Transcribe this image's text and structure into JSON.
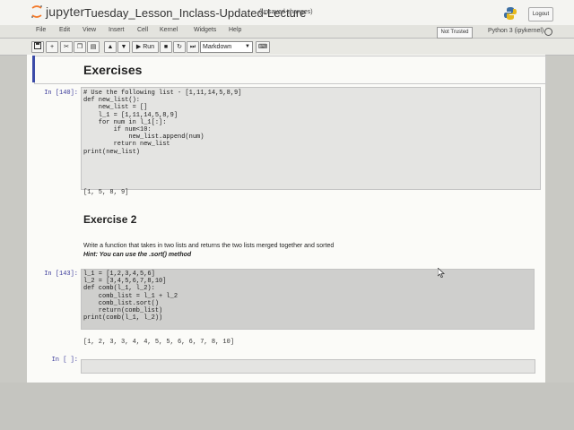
{
  "header": {
    "app_name": "jupyter",
    "notebook_title": "Tuesday_Lesson_Inclass-Updated-Lecture",
    "save_status": "(unsaved changes)",
    "logout_label": "Logout"
  },
  "menu": {
    "items": [
      {
        "label": "File"
      },
      {
        "label": "Edit"
      },
      {
        "label": "View"
      },
      {
        "label": "Insert"
      },
      {
        "label": "Cell"
      },
      {
        "label": "Kernel"
      },
      {
        "label": "Widgets"
      },
      {
        "label": "Help"
      }
    ],
    "trust_label": "Not Trusted",
    "kernel_label": "Python 3 (ipykernel)"
  },
  "toolbar": {
    "run_label": "Run",
    "cell_type": "Markdown"
  },
  "cells": {
    "heading1": "Exercises",
    "cell1_prompt": "In [140]:",
    "cell1_code": "# Use the following list - [1,11,14,5,8,9]\ndef new_list():\n    new_list = []\n    l_1 = [1,11,14,5,8,9]\n    for num in l_1[:]:\n        if num<10:\n            new_list.append(num)\n        return new_list\nprint(new_list)",
    "cell1_output": "[1, 5, 8, 9]",
    "heading2": "Exercise 2",
    "md_text": "Write a function that takes in two lists and returns the two lists merged together and sorted",
    "md_hint": "Hint: You can use the .sort() method",
    "cell2_prompt": "In [143]:",
    "cell2_code": "l_1 = [1,2,3,4,5,6]\nl_2 = [3,4,5,6,7,8,10]\ndef comb(l_1, l_2):\n    comb_list = l_1 + l_2\n    comb_list.sort()\n    return(comb_list)\nprint(comb(l_1, l_2))",
    "cell2_output": "[1, 2, 3, 3, 4, 4, 5, 5, 6, 6, 7, 8, 10]",
    "cell3_prompt": "In [ ]:"
  }
}
